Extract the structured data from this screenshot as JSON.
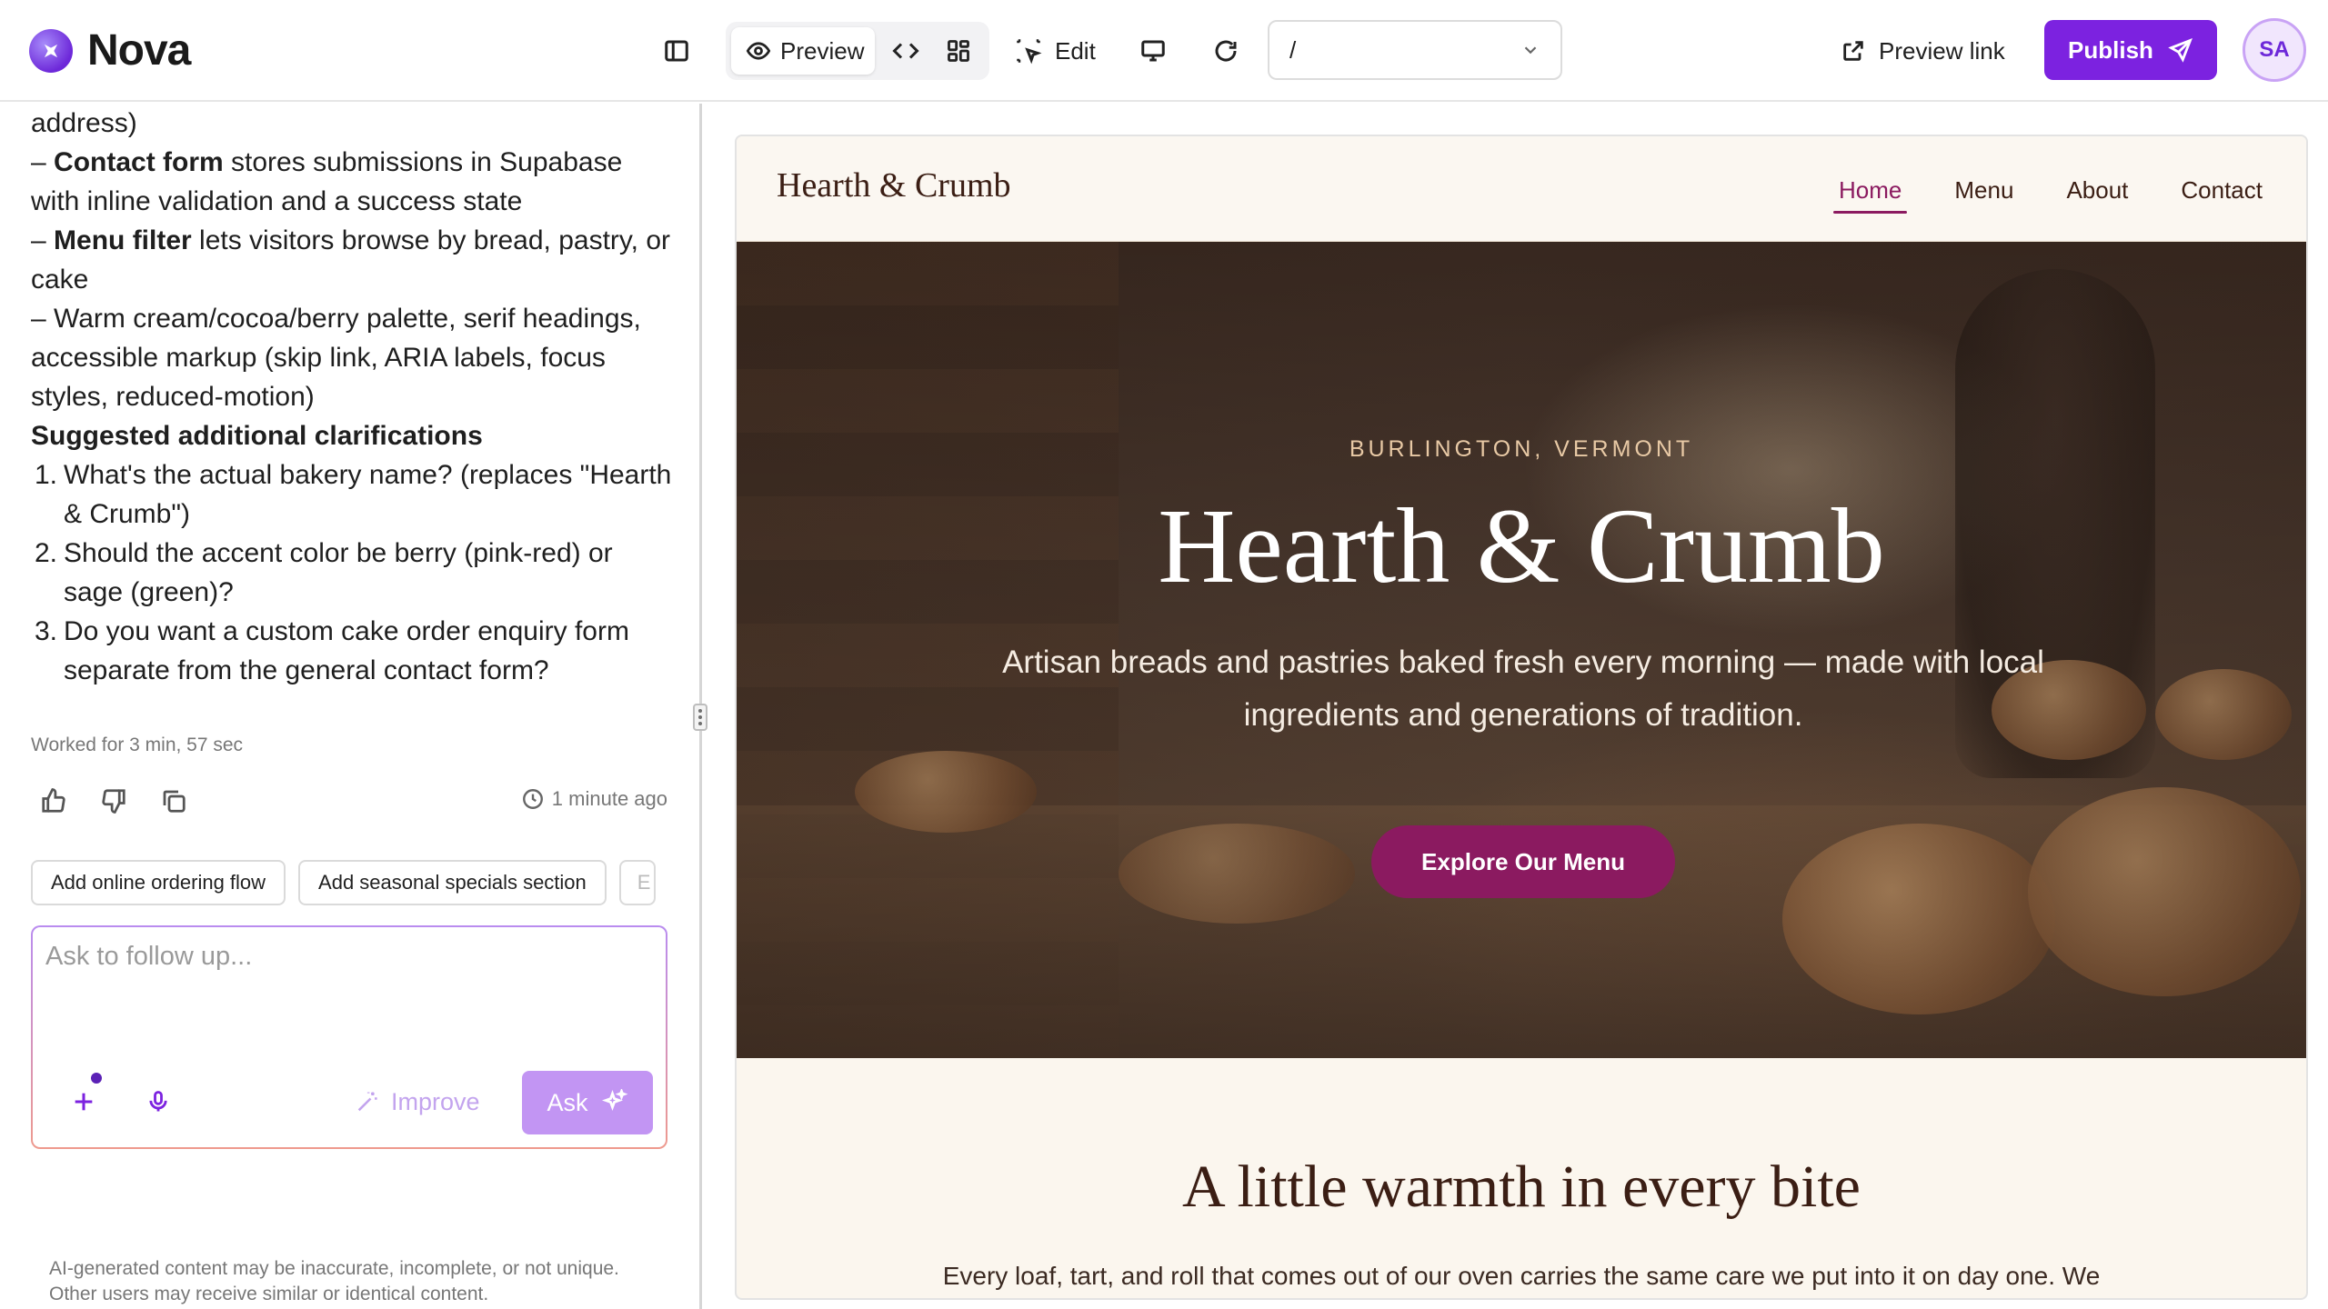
{
  "app": {
    "name": "Nova"
  },
  "toolbar": {
    "preview_label": "Preview",
    "edit_label": "Edit",
    "route_value": "/",
    "preview_link_label": "Preview link",
    "publish_label": "Publish",
    "avatar_initials": "SA"
  },
  "chat": {
    "line_address": "address)",
    "bullets": [
      {
        "prefix": "– ",
        "bold": "Contact form",
        "rest": " stores submissions in Supabase with inline validation and a success state"
      },
      {
        "prefix": "– ",
        "bold": "Menu filter",
        "rest": " lets visitors browse by bread, pastry, or cake"
      },
      {
        "prefix": "– ",
        "bold": "",
        "rest": "Warm cream/cocoa/berry palette, serif headings, accessible markup (skip link, ARIA labels, focus styles, reduced-motion)"
      }
    ],
    "clarifications_heading": "Suggested additional clarifications",
    "clarifications": [
      {
        "num": "1.",
        "text": "What's the actual bakery name? (replaces \"Hearth & Crumb\")"
      },
      {
        "num": "2.",
        "text": "Should the accent color be berry (pink-red) or sage (green)?"
      },
      {
        "num": "3.",
        "text": "Do you want a custom cake order enquiry form separate from the general contact form?"
      }
    ],
    "worked_for": "Worked for 3 min, 57 sec",
    "time_ago": "1 minute ago",
    "suggestions": [
      "Add online ordering flow",
      "Add seasonal specials section",
      "E"
    ],
    "composer_placeholder": "Ask to follow up...",
    "improve_label": "Improve",
    "ask_label": "Ask",
    "disclaimer": "AI-generated content may be inaccurate, incomplete, or not unique. Other users may receive similar or identical content."
  },
  "site": {
    "brand": "Hearth & Crumb",
    "nav": [
      "Home",
      "Menu",
      "About",
      "Contact"
    ],
    "hero": {
      "kicker": "BURLINGTON, VERMONT",
      "title": "Hearth & Crumb",
      "subtitle": "Artisan breads and pastries baked fresh every morning — made with local ingredients and generations of tradition.",
      "cta": "Explore Our Menu"
    },
    "intro": {
      "title": "A little warmth in every bite",
      "body": "Every loaf, tart, and roll that comes out of our oven carries the same care we put into it on day one. We"
    }
  },
  "colors": {
    "brand_purple": "#7c22e0",
    "site_accent": "#8b1a60",
    "site_cream": "#fbf6ee",
    "site_cocoa": "#3b1e14"
  }
}
